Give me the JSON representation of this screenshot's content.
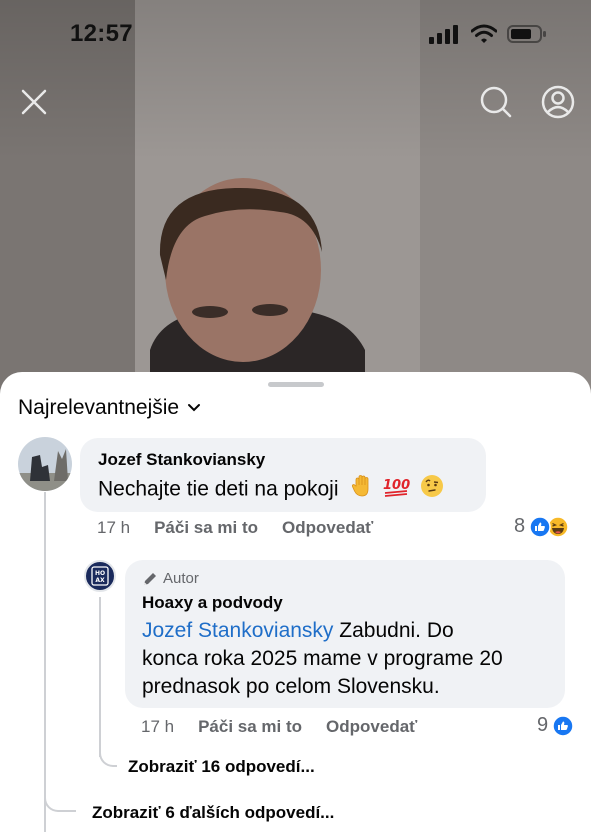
{
  "status_bar": {
    "time": "12:57"
  },
  "video_controls": {
    "close_icon": "close-icon",
    "search_icon": "search-icon",
    "profile_icon": "profile-icon"
  },
  "sheet": {
    "sort_label": "Najrelevantnejšie",
    "comment": {
      "author": "Jozef Stankoviansky",
      "text": "Nechajte tie deti na pokoji",
      "emojis": [
        "raised-hand-icon",
        "hundred-points-icon",
        "face-with-raised-eyebrow-icon"
      ],
      "time": "17 h",
      "like": "Páči sa mi to",
      "reply": "Odpovedať",
      "reaction_count": "8"
    },
    "reply": {
      "badge": "Autor",
      "author": "Hoaxy a podvody",
      "mention": "Jozef Stankoviansky",
      "text_line1": " Zabudni. Do",
      "text_line2": "konca roka 2025 mame v programe 20",
      "text_line3": "prednasok po celom Slovensku.",
      "avatar_letters_top": "HO",
      "avatar_letters_bottom": "AX",
      "time": "17 h",
      "like": "Páči sa mi to",
      "reply": "Odpovedať",
      "reaction_count": "9"
    },
    "show_replies": "Zobraziť 16 odpovedí...",
    "show_more_replies": "Zobraziť 6 ďalších odpovedí..."
  },
  "colors": {
    "like_blue": "#1877f2",
    "haha_yellow": "#f7b928",
    "mention_blue": "#1f6ec8",
    "bubble_bg": "#f0f2f5"
  }
}
